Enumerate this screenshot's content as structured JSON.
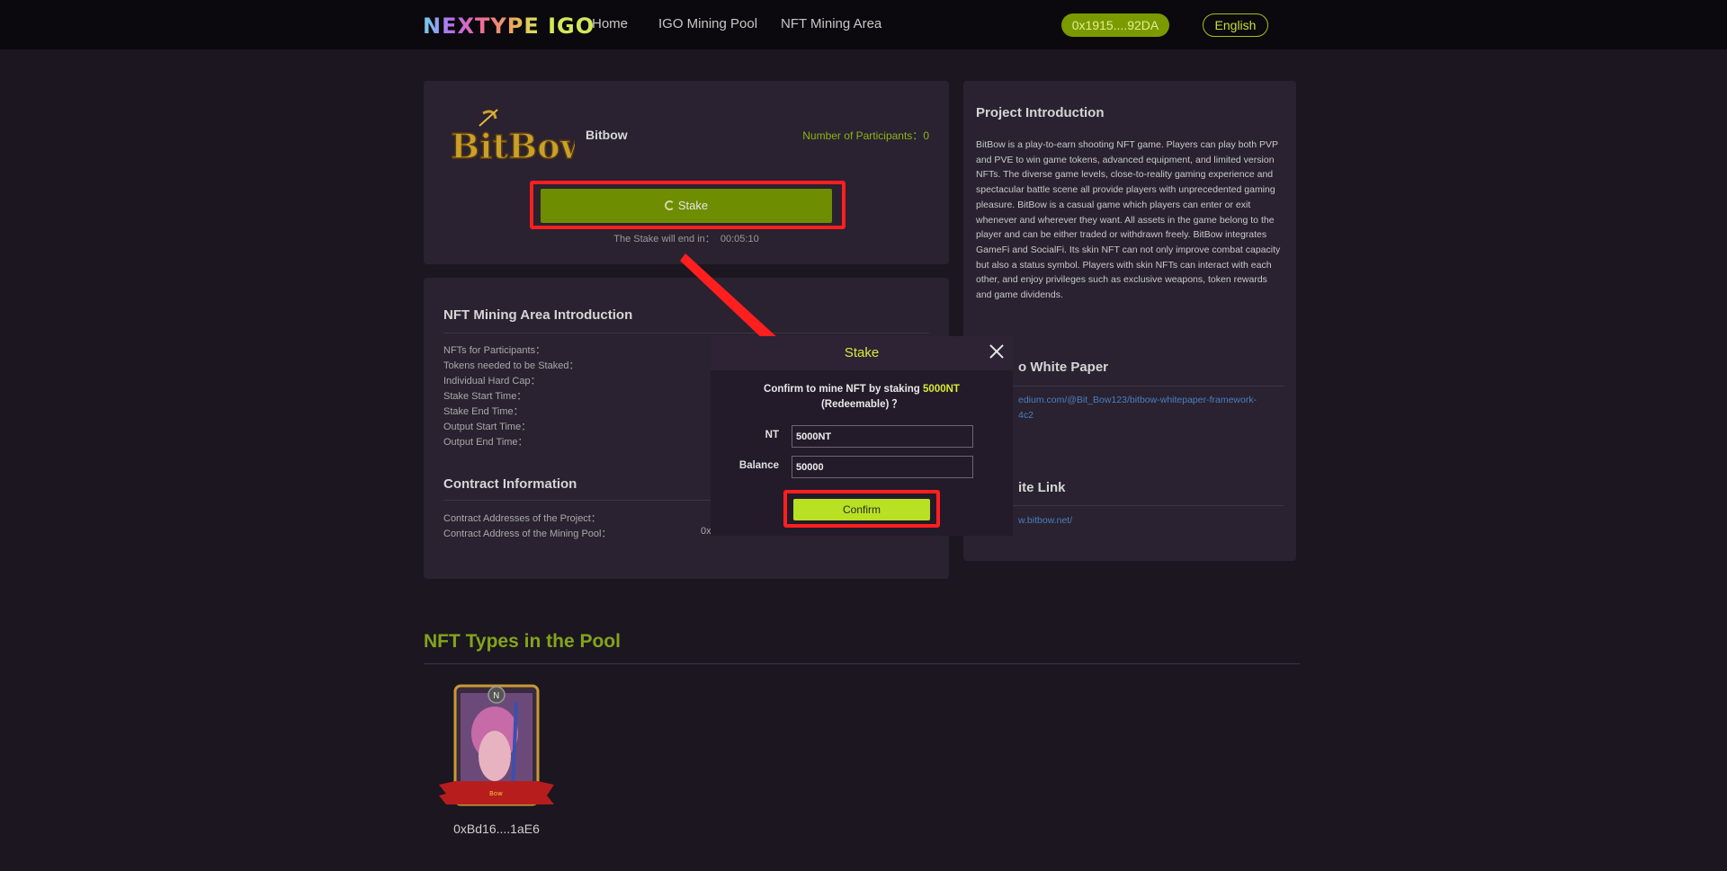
{
  "header": {
    "logo_a": "NEXTYPE",
    "logo_b": "IGO",
    "nav": [
      "Home",
      "IGO Mining Pool",
      "NFT Mining Area"
    ],
    "wallet": "0x1915....92DA",
    "language": "English"
  },
  "project": {
    "name": "Bitbow",
    "logo_text": "BitBow",
    "participants_label": "Number of Participants：",
    "participants_value": "0",
    "stake_label": "Stake",
    "stake_end_label": "The Stake will end in：",
    "stake_end_value": "00:05:10"
  },
  "mining_intro": {
    "title": "NFT Mining Area Introduction",
    "labels": [
      "NFTs for Participants：",
      "Tokens needed to be Staked：",
      "Individual Hard Cap：",
      "Stake Start Time：",
      "Stake End Time：",
      "Output Start Time：",
      "Output End Time："
    ]
  },
  "contract": {
    "title": "Contract Information",
    "labels": [
      "Contract Addresses of the Project：",
      "Contract Address of the Mining Pool："
    ],
    "pool_value_partial": "0x"
  },
  "right": {
    "intro_title": "Project Introduction",
    "intro_text": "BitBow is a play-to-earn shooting NFT game. Players can play both PVP and PVE to win game tokens, advanced equipment, and limited version NFTs. The diverse game levels, close-to-reality gaming experience and spectacular battle scene all provide players with unprecedented gaming pleasure. BitBow is a casual game which players can enter or exit whenever and wherever they want. All assets in the game belong to the player and can be either traded or withdrawn freely. BitBow integrates GameFi and SocialFi. Its skin NFT can not only improve combat capacity but also a status symbol. Players with skin NFTs can interact with each other, and enjoy privileges such as exclusive weapons, token rewards and game dividends.",
    "whitepaper_title": "o White Paper",
    "whitepaper_link_1": "edium.com/@Bit_Bow123/bitbow-whitepaper-framework-",
    "whitepaper_link_2": "4c2",
    "website_title": "ite Link",
    "website_link": "w.bitbow.net/"
  },
  "pool": {
    "title": "NFT Types in the Pool",
    "nft_address": "0xBd16....1aE6",
    "nft_badge": "N",
    "nft_ribbon": "Bow"
  },
  "modal": {
    "title": "Stake",
    "msg_prefix": "Confirm to mine NFT by staking",
    "msg_amount": "5000NT",
    "msg_suffix": "(Redeemable) ？",
    "nt_label": "NT",
    "nt_value": "5000NT",
    "balance_label": "Balance",
    "balance_value": "50000",
    "confirm_label": "Confirm"
  },
  "colors": {
    "accent": "#b9e123",
    "stake_button": "#6f8d00",
    "annotation": "#ff1f1f"
  }
}
